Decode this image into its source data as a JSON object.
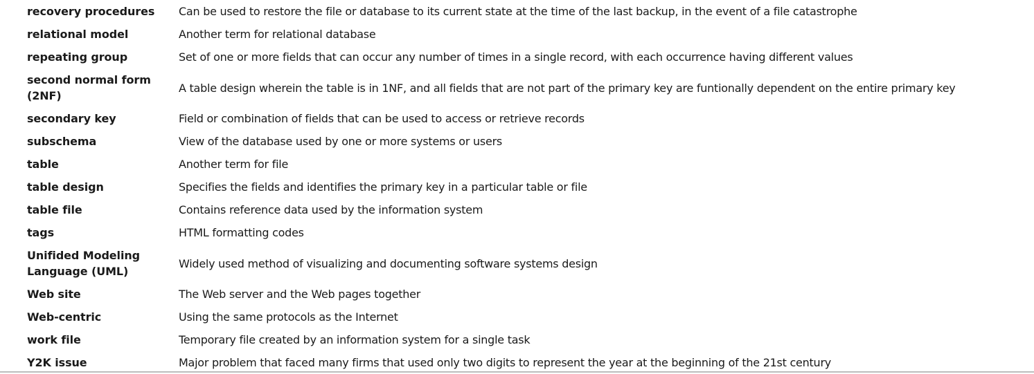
{
  "glossary": {
    "entries": [
      {
        "term": "recovery procedures",
        "definition": "Can be used to restore the file or database to its current state at the time of the last backup, in the event of a file catastrophe"
      },
      {
        "term": "relational model",
        "definition": "Another term for relational database"
      },
      {
        "term": "repeating group",
        "definition": "Set of one or more fields that can occur any number of times in a single record, with each occurrence having different values"
      },
      {
        "term": "second normal form (2NF)",
        "definition": "A table design wherein the table is in 1NF, and all fields that are not part of the primary key are funtionally dependent on the entire primary key"
      },
      {
        "term": "secondary key",
        "definition": "Field or combination of fields that can be used to access or retrieve records"
      },
      {
        "term": "subschema",
        "definition": "View of the database used by one or more systems or users"
      },
      {
        "term": "table",
        "definition": "Another term for file"
      },
      {
        "term": "table design",
        "definition": "Specifies the fields and identifies the primary key in a particular table or file"
      },
      {
        "term": "table file",
        "definition": "Contains reference data used by the information system"
      },
      {
        "term": "tags",
        "definition": "HTML formatting codes"
      },
      {
        "term": "Unifided Modeling Language (UML)",
        "definition": "Widely used method of visualizing and documenting software systems design"
      },
      {
        "term": "Web site",
        "definition": "The Web server and the Web pages together"
      },
      {
        "term": "Web-centric",
        "definition": "Using the same protocols as the Internet"
      },
      {
        "term": "work file",
        "definition": "Temporary file created by an information system for a single task"
      },
      {
        "term": "Y2K issue",
        "definition": "Major problem that faced many firms that used only two digits to represent the year at the beginning of the 21st century"
      }
    ]
  }
}
